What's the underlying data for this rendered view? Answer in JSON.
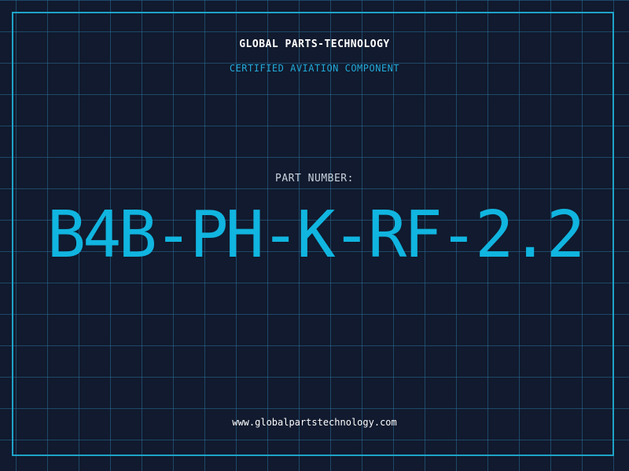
{
  "header": {
    "company": "GLOBAL PARTS-TECHNOLOGY",
    "subtitle": "CERTIFIED AVIATION COMPONENT"
  },
  "main": {
    "label": "PART NUMBER:",
    "part_number": "B4B-PH-K-RF-2.2"
  },
  "footer": {
    "url": "www.globalpartstechnology.com"
  },
  "colors": {
    "background": "#111a2e",
    "grid": "#286e96",
    "accent": "#10b5e0",
    "border": "#1ea3c8",
    "text": "#ffffff"
  }
}
